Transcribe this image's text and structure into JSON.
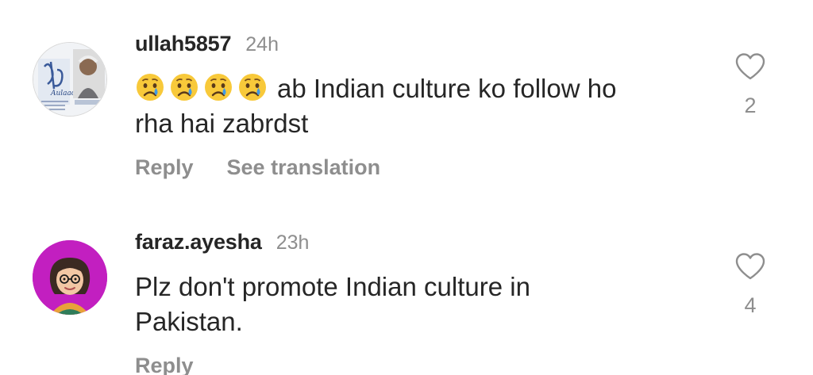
{
  "comments": [
    {
      "username": "ullah5857",
      "timestamp": "24h",
      "emojis": [
        "crying-face",
        "crying-face",
        "crying-face",
        "crying-face"
      ],
      "text_line1": "ab Indian culture ko follow ho",
      "text_line2": "rha hai zabrdst",
      "actions": {
        "reply": "Reply",
        "translate": "See translation"
      },
      "like_count": "2"
    },
    {
      "username": "faraz.ayesha",
      "timestamp": "23h",
      "text_line1": "Plz don't promote Indian culture in",
      "text_line2": "Pakistan.",
      "actions": {
        "reply": "Reply"
      },
      "like_count": "4"
    }
  ],
  "colors": {
    "primary_text": "#262626",
    "secondary_text": "#8e8e8e",
    "avatar2_background": "#c21fc0",
    "emoji_face": "#f8c93a",
    "emoji_tear": "#3f9ae8"
  }
}
